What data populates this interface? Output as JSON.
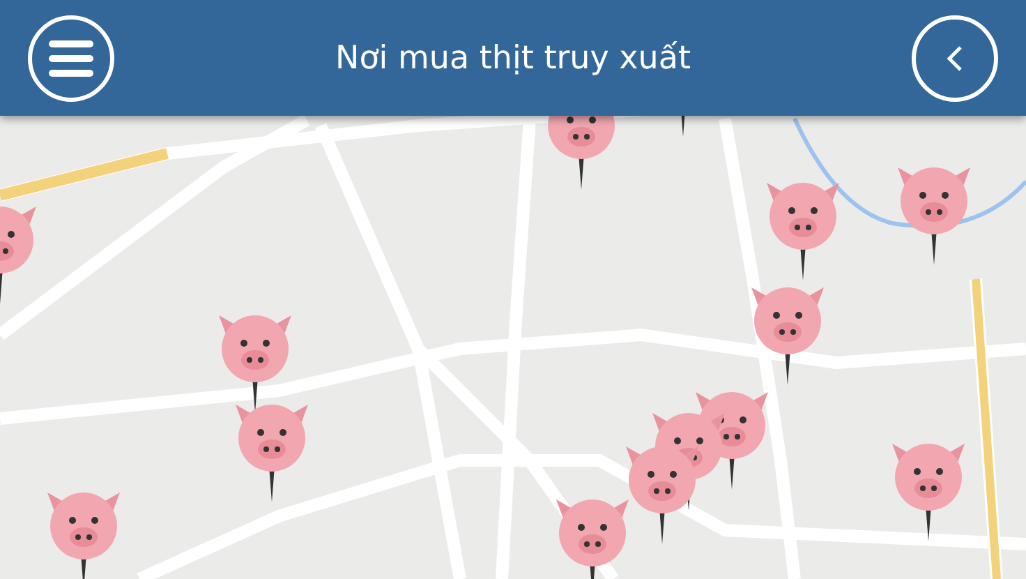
{
  "header": {
    "title": "Nơi mua thịt truy xuất"
  }
}
